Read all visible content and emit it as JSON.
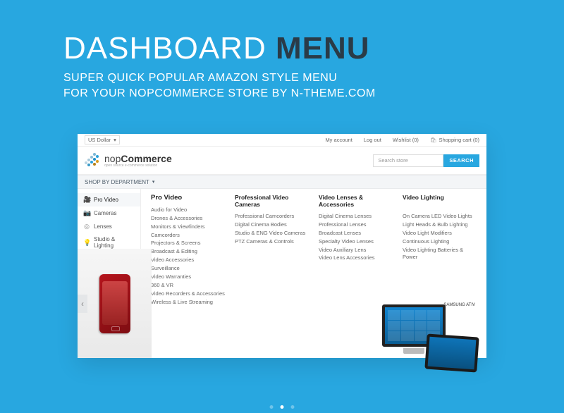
{
  "hero": {
    "title_a": "DASHBOARD",
    "title_b": "MENU",
    "sub_line1": "SUPER QUICK POPULAR AMAZON STYLE MENU",
    "sub_line2": "FOR YOUR NOPCOMMERCE STORE BY N-THEME.COM"
  },
  "util": {
    "currency": "US Dollar",
    "links": {
      "account": "My account",
      "logout": "Log out",
      "wishlist": "Wishlist (0)",
      "cart": "Shopping cart (0)"
    }
  },
  "logo": {
    "name_a": "nop",
    "name_b": "Commerce",
    "tag": "open source e-commerce solution"
  },
  "search": {
    "placeholder": "Search store",
    "button": "SEARCH"
  },
  "dept_label": "SHOP BY DEPARTMENT",
  "sidebar": [
    {
      "icon": "🎥",
      "label": "Pro Video"
    },
    {
      "icon": "📷",
      "label": "Cameras"
    },
    {
      "icon": "◎",
      "label": "Lenses"
    },
    {
      "icon": "💡",
      "label": "Studio & Lighting"
    }
  ],
  "col0": {
    "title": "Pro Video",
    "items": [
      "Audio for Video",
      "Drones & Accessories",
      "Monitors & Viewfinders",
      "Camcorders",
      "Projectors & Screens",
      "Broadcast & Editing",
      "Video Accessories",
      "Surveillance",
      "Video Warranties",
      "360 & VR",
      "Video Recorders & Accessories",
      "Wireless & Live Streaming"
    ]
  },
  "col1": {
    "title": "Professional Video Cameras",
    "items": [
      "Professional Camcorders",
      "Digital Cinema Bodies",
      "Studio & ENG Video Cameras",
      "PTZ Cameras & Controls"
    ]
  },
  "col2": {
    "title": "Video Lenses & Accessories",
    "items": [
      "Digital Cinema Lenses",
      "Professional Lenses",
      "Broadcast Lenses",
      "Specialty Video Lenses",
      "Video Auxiliary Lens",
      "Video Lens Accessories"
    ]
  },
  "col3": {
    "title": "Video Lighting",
    "items": [
      "On Camera LED Video Lights",
      "Light Heads & Bulb Lighting",
      "Video Light Modifiers",
      "Continuous Lighting",
      "Video Lighting Batteries & Power"
    ]
  },
  "brand_right": "SAMSUNG ATIV"
}
